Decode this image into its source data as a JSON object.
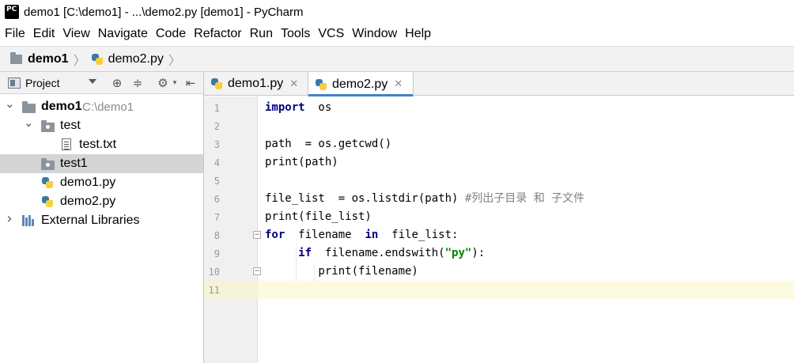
{
  "window": {
    "title": "demo1 [C:\\demo1] - ...\\demo2.py [demo1] - PyCharm",
    "logo_text": "PC"
  },
  "menu": [
    "File",
    "Edit",
    "View",
    "Navigate",
    "Code",
    "Refactor",
    "Run",
    "Tools",
    "VCS",
    "Window",
    "Help"
  ],
  "navbar": {
    "project": "demo1",
    "separator": "〉",
    "file": "demo2.py"
  },
  "project_panel": {
    "title": "Project",
    "tree": [
      {
        "label": "demo1",
        "hint": "C:\\demo1",
        "type": "folder",
        "expanded": true,
        "level": 0,
        "bold": true
      },
      {
        "label": "test",
        "type": "folder",
        "expanded": true,
        "level": 1
      },
      {
        "label": "test.txt",
        "type": "text-file",
        "level": 2
      },
      {
        "label": "test1",
        "type": "folder",
        "level": 1,
        "selected": true
      },
      {
        "label": "demo1.py",
        "type": "python-file",
        "level": 1
      },
      {
        "label": "demo2.py",
        "type": "python-file",
        "level": 1
      },
      {
        "label": "External Libraries",
        "type": "library",
        "expanded": false,
        "level": 0
      }
    ]
  },
  "tabs": [
    {
      "label": "demo1.py",
      "close": "✕",
      "active": false
    },
    {
      "label": "demo2.py",
      "close": "✕",
      "active": true
    }
  ],
  "editor": {
    "line_numbers": [
      "1",
      "2",
      "3",
      "4",
      "5",
      "6",
      "7",
      "8",
      "9",
      "10",
      "11"
    ],
    "current_line": "11",
    "lines": [
      [
        {
          "t": "import",
          "c": "kw"
        },
        {
          "t": "  os",
          "c": ""
        }
      ],
      [],
      [
        {
          "t": "path  = os.getcwd()",
          "c": ""
        }
      ],
      [
        {
          "t": "print(path)",
          "c": ""
        }
      ],
      [],
      [
        {
          "t": "file_list  = os.listdir(path) ",
          "c": ""
        },
        {
          "t": "#列出子目录 和 子文件",
          "c": "cmt"
        }
      ],
      [
        {
          "t": "print(file_list)",
          "c": ""
        }
      ],
      [
        {
          "t": "for",
          "c": "kw"
        },
        {
          "t": "  filename  ",
          "c": ""
        },
        {
          "t": "in",
          "c": "kw"
        },
        {
          "t": "  file_list:",
          "c": ""
        }
      ],
      [
        {
          "t": "     ",
          "c": ""
        },
        {
          "t": "if",
          "c": "kw"
        },
        {
          "t": "  filename.endswith(",
          "c": ""
        },
        {
          "t": "\"py\"",
          "c": "str"
        },
        {
          "t": "):",
          "c": ""
        }
      ],
      [
        {
          "t": "        print(filename)",
          "c": ""
        }
      ],
      []
    ]
  },
  "colors": {
    "keyword": "#000080",
    "string": "#008000",
    "comment": "#808080",
    "current_line": "#fcfae1",
    "selection": "#d4d4d4",
    "tab_accent": "#4083c9"
  }
}
